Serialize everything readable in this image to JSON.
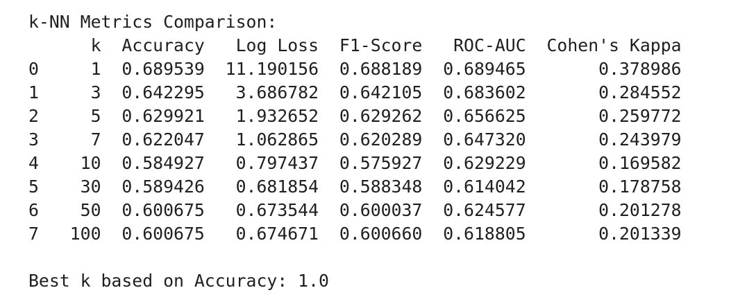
{
  "title": "k-NN Metrics Comparison:",
  "table": {
    "columns": [
      "k",
      "Accuracy",
      "Log Loss",
      "F1-Score",
      "ROC-AUC",
      "Cohen's Kappa"
    ],
    "rows": [
      {
        "index": "0",
        "k": "1",
        "accuracy": "0.689539",
        "log_loss": "11.190156",
        "f1": "0.688189",
        "roc_auc": "0.689465",
        "kappa": "0.378986"
      },
      {
        "index": "1",
        "k": "3",
        "accuracy": "0.642295",
        "log_loss": "3.686782",
        "f1": "0.642105",
        "roc_auc": "0.683602",
        "kappa": "0.284552"
      },
      {
        "index": "2",
        "k": "5",
        "accuracy": "0.629921",
        "log_loss": "1.932652",
        "f1": "0.629262",
        "roc_auc": "0.656625",
        "kappa": "0.259772"
      },
      {
        "index": "3",
        "k": "7",
        "accuracy": "0.622047",
        "log_loss": "1.062865",
        "f1": "0.620289",
        "roc_auc": "0.647320",
        "kappa": "0.243979"
      },
      {
        "index": "4",
        "k": "10",
        "accuracy": "0.584927",
        "log_loss": "0.797437",
        "f1": "0.575927",
        "roc_auc": "0.629229",
        "kappa": "0.169582"
      },
      {
        "index": "5",
        "k": "30",
        "accuracy": "0.589426",
        "log_loss": "0.681854",
        "f1": "0.588348",
        "roc_auc": "0.614042",
        "kappa": "0.178758"
      },
      {
        "index": "6",
        "k": "50",
        "accuracy": "0.600675",
        "log_loss": "0.673544",
        "f1": "0.600037",
        "roc_auc": "0.624577",
        "kappa": "0.201278"
      },
      {
        "index": "7",
        "k": "100",
        "accuracy": "0.600675",
        "log_loss": "0.674671",
        "f1": "0.600660",
        "roc_auc": "0.618805",
        "kappa": "0.201339"
      }
    ]
  },
  "best_line": "Best k based on Accuracy: 1.0"
}
